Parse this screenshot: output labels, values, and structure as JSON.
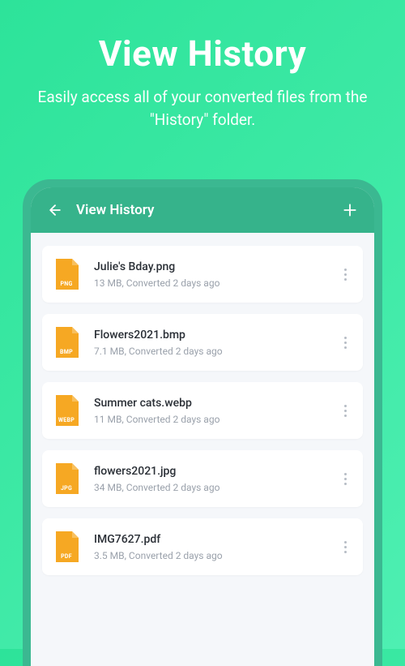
{
  "hero": {
    "title": "View History",
    "subtitle": "Easily access all of your converted files from the \"History\" folder."
  },
  "appbar": {
    "title": "View History"
  },
  "files": [
    {
      "name": "Julie's Bday.png",
      "meta": "13 MB, Converted 2 days ago",
      "ext": "PNG"
    },
    {
      "name": "Flowers2021.bmp",
      "meta": "7.1 MB, Converted 2 days ago",
      "ext": "BMP"
    },
    {
      "name": "Summer cats.webp",
      "meta": "11 MB, Converted 2 days ago",
      "ext": "WEBP"
    },
    {
      "name": "flowers2021.jpg",
      "meta": "34 MB, Converted 2 days ago",
      "ext": "JPG"
    },
    {
      "name": "IMG7627.pdf",
      "meta": "3.5 MB, Converted 2 days ago",
      "ext": "PDF"
    }
  ],
  "colors": {
    "fileIcon": "#f6a823"
  }
}
